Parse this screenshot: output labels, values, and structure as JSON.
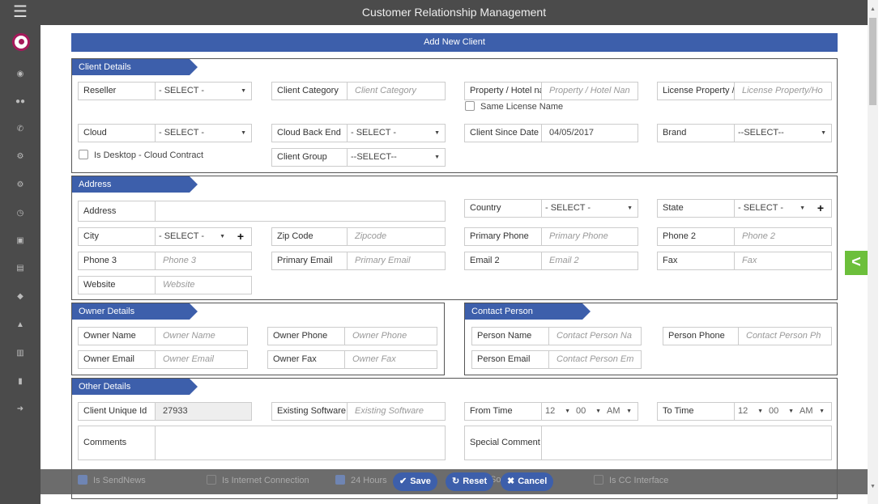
{
  "app": {
    "title": "Customer Relationship Management"
  },
  "form": {
    "title": "Add New Client"
  },
  "sections": {
    "client": "Client Details",
    "address": "Address",
    "owner": "Owner Details",
    "contact": "Contact Person",
    "other": "Other Details"
  },
  "client": {
    "reseller": {
      "label": "Reseller",
      "value": "- SELECT -"
    },
    "category": {
      "label": "Client Category",
      "placeholder": "Client Category"
    },
    "property": {
      "label": "Property / Hotel na",
      "placeholder": "Property / Hotel Nan"
    },
    "license_property": {
      "label": "License Property /",
      "placeholder": "License Property/Ho"
    },
    "same_license": "Same License Name",
    "cloud": {
      "label": "Cloud",
      "value": "- SELECT -"
    },
    "cloud_backend": {
      "label": "Cloud Back End",
      "value": "- SELECT -"
    },
    "client_since": {
      "label": "Client Since Date",
      "value": "04/05/2017"
    },
    "brand": {
      "label": "Brand",
      "value": "--SELECT--"
    },
    "is_desktop": "Is Desktop - Cloud Contract",
    "group": {
      "label": "Client Group",
      "value": "--SELECT--"
    }
  },
  "address": {
    "address": {
      "label": "Address"
    },
    "country": {
      "label": "Country",
      "value": "- SELECT -"
    },
    "state": {
      "label": "State",
      "value": "- SELECT -"
    },
    "city": {
      "label": "City",
      "value": "- SELECT -"
    },
    "zip": {
      "label": "Zip Code",
      "placeholder": "Zipcode"
    },
    "primary_phone": {
      "label": "Primary Phone",
      "placeholder": "Primary Phone"
    },
    "phone2": {
      "label": "Phone 2",
      "placeholder": "Phone 2"
    },
    "phone3": {
      "label": "Phone 3",
      "placeholder": "Phone 3"
    },
    "primary_email": {
      "label": "Primary Email",
      "placeholder": "Primary Email"
    },
    "email2": {
      "label": "Email 2",
      "placeholder": "Email 2"
    },
    "fax": {
      "label": "Fax",
      "placeholder": "Fax"
    },
    "website": {
      "label": "Website",
      "placeholder": "Website"
    }
  },
  "owner": {
    "name": {
      "label": "Owner Name",
      "placeholder": "Owner Name"
    },
    "phone": {
      "label": "Owner Phone",
      "placeholder": "Owner Phone"
    },
    "email": {
      "label": "Owner Email",
      "placeholder": "Owner Email"
    },
    "fax": {
      "label": "Owner Fax",
      "placeholder": "Owner Fax"
    }
  },
  "contact": {
    "name": {
      "label": "Person Name",
      "placeholder": "Contact Person Na"
    },
    "phone": {
      "label": "Person Phone",
      "placeholder": "Contact Person Ph"
    },
    "email": {
      "label": "Person Email",
      "placeholder": "Contact Person Em"
    }
  },
  "other": {
    "unique_id": {
      "label": "Client Unique Id",
      "value": "27933"
    },
    "existing_software": {
      "label": "Existing Software",
      "placeholder": "Existing Software"
    },
    "from_time": {
      "label": "From Time",
      "hour": "12",
      "minute": "00",
      "ampm": "AM"
    },
    "to_time": {
      "label": "To Time",
      "hour": "12",
      "minute": "00",
      "ampm": "AM"
    },
    "comments": {
      "label": "Comments"
    },
    "special_comment": {
      "label": "Special Comment"
    }
  },
  "footer": {
    "is_sendnews": "Is SendNews",
    "is_internet": "Is Internet Connection",
    "hours24": "24 Hours",
    "hidden_text": "So",
    "is_cc": "Is CC Interface",
    "save": "Save",
    "reset": "Reset",
    "cancel": "Cancel"
  },
  "icons": {
    "plus": "+",
    "toggle": "<"
  },
  "colors": {
    "accent": "#3d5fab",
    "sidebar": "#4b4b4b",
    "toggle": "#6cbf3b"
  }
}
